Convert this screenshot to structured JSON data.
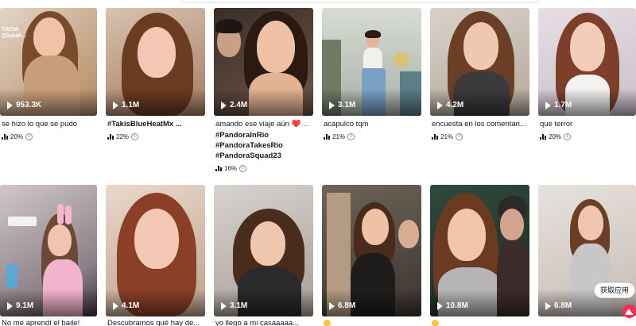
{
  "grid": {
    "row1": [
      {
        "views": "953.3K",
        "caption": "se hizo lo que se pudo",
        "stat": "20%",
        "tiktok_label": "TikTok",
        "tiktok_handle": "@lunah..."
      },
      {
        "views": "1.1M",
        "caption": "#TakisBlueHeatMx ...",
        "stat": "22%"
      },
      {
        "views": "2.4M",
        "caption": "amando ese viaje aún",
        "caption_emoji": "❤️ ...",
        "hashtags": [
          "#PandoraInRio",
          "#PandoraTakesRio",
          "#PandoraSquad23"
        ],
        "stat": "16%"
      },
      {
        "views": "3.1M",
        "caption": "acapulco tqm",
        "stat": "21%"
      },
      {
        "views": "4.2M",
        "caption": "encuesta en los comentari...",
        "stat": "21%"
      },
      {
        "views": "1.7M",
        "caption": "que terror",
        "stat": "20%"
      }
    ],
    "row2": [
      {
        "views": "9.1M",
        "caption": "No me aprendí el baile!"
      },
      {
        "views": "4.1M",
        "caption": "Descubramos qué hay de..."
      },
      {
        "views": "3.1M",
        "caption": "yo llego a mi casaaaaa..."
      },
      {
        "views": "6.8M",
        "caption": ""
      },
      {
        "views": "10.8M",
        "caption": ""
      },
      {
        "views": "6.8M",
        "caption": ""
      }
    ]
  },
  "floating": {
    "get_app_label": "获取应用"
  },
  "icons": {
    "play": "play-icon",
    "stat": "bar-chart-icon",
    "info": "info-icon",
    "back_to_top": "arrow-up-icon"
  },
  "colors": {
    "accent": "#fe2c55",
    "text": "#161823"
  }
}
